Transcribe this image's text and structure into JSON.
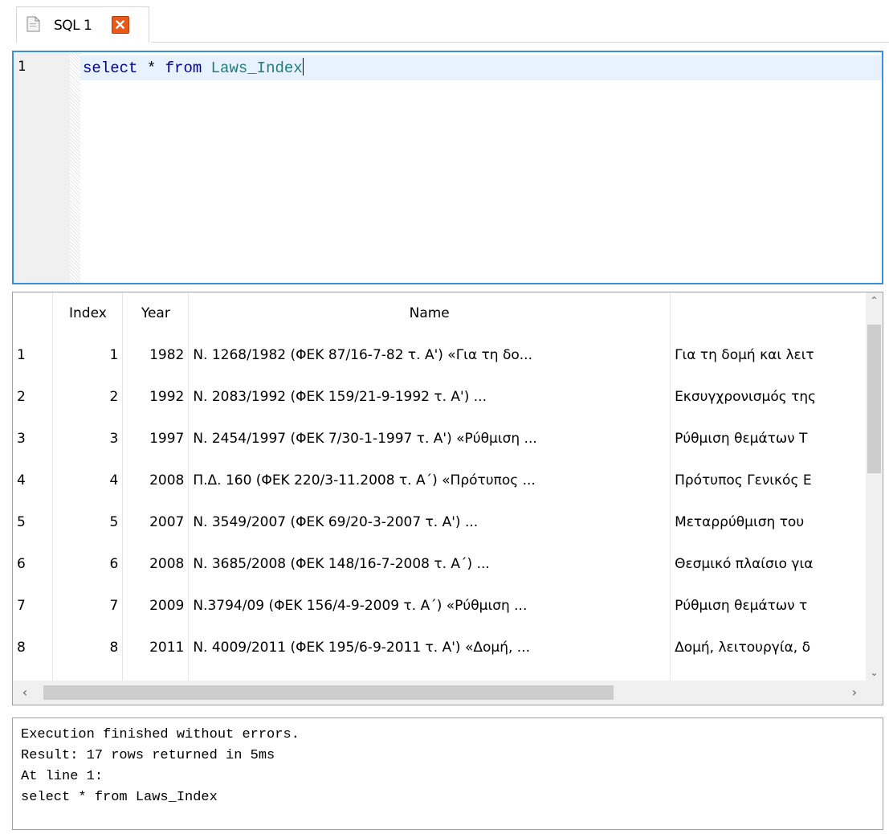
{
  "tab": {
    "label": "SQL 1"
  },
  "editor": {
    "line_number": "1",
    "keyword_select": "select",
    "star": " * ",
    "keyword_from": "from",
    "table_name": "Laws_Index"
  },
  "grid": {
    "headers": {
      "index": "Index",
      "year": "Year",
      "name": "Name",
      "description": ""
    },
    "rows": [
      {
        "rn": "1",
        "index": "1",
        "year": "1982",
        "name": "Ν. 1268/1982 (ΦΕΚ 87/16-7-82 τ. Α') «Για τη δο...",
        "desc": "Για τη δομή και λειτ"
      },
      {
        "rn": "2",
        "index": "2",
        "year": "1992",
        "name": "Ν. 2083/1992 (ΦΕΚ 159/21-9-1992 τ. Α') ...",
        "desc": "Εκσυγχρονισμός της"
      },
      {
        "rn": "3",
        "index": "3",
        "year": "1997",
        "name": "Ν. 2454/1997 (ΦΕΚ 7/30-1-1997 τ. Α') «Ρύθμιση ...",
        "desc": "Ρύθμιση θεμάτων Τ"
      },
      {
        "rn": "4",
        "index": "4",
        "year": "2008",
        "name": "Π.Δ. 160 (ΦΕΚ 220/3-11.2008 τ. Α΄) «Πρότυπος ...",
        "desc": "Πρότυπος Γενικός Ε"
      },
      {
        "rn": "5",
        "index": "5",
        "year": "2007",
        "name": "Ν. 3549/2007 (ΦΕΚ 69/20-3-2007 τ. Α') ...",
        "desc": "Μεταρρύθμιση του"
      },
      {
        "rn": "6",
        "index": "6",
        "year": "2008",
        "name": "Ν. 3685/2008 (ΦΕΚ 148/16-7-2008 τ. Α΄) ...",
        "desc": "Θεσμικό πλαίσιο για"
      },
      {
        "rn": "7",
        "index": "7",
        "year": "2009",
        "name": "Ν.3794/09 (ΦΕΚ 156/4-9-2009 τ. Α΄) «Ρύθμιση ...",
        "desc": "Ρύθμιση θεμάτων τ"
      },
      {
        "rn": "8",
        "index": "8",
        "year": "2011",
        "name": "Ν. 4009/2011 (ΦΕΚ 195/6-9-2011 τ. Α') «Δομή, ...",
        "desc": "Δομή, λειτουργία, δ"
      }
    ]
  },
  "log": {
    "line1": "Execution finished without errors.",
    "line2": "Result: 17 rows returned in 5ms",
    "line3": "At line 1:",
    "line4": "select * from Laws_Index"
  },
  "colors": {
    "accent": "#3b8fd9",
    "close": "#e8591a",
    "current_line": "#e8f2fe"
  },
  "icons": {
    "tab_icon": "document-icon",
    "close_icon": "close-icon"
  }
}
